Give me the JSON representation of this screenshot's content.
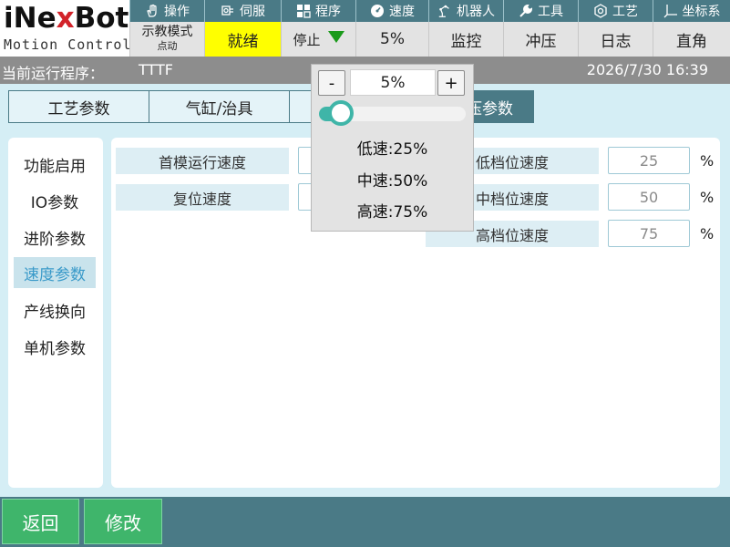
{
  "logo": {
    "brand_pre": "iNe",
    "brand_x": "x",
    "brand_post": "Bot",
    "subtitle": "Motion Control"
  },
  "top_tabs": [
    {
      "label": "操作",
      "icon": "hand-icon"
    },
    {
      "label": "伺服",
      "icon": "servo-icon"
    },
    {
      "label": "程序",
      "icon": "grid-icon"
    },
    {
      "label": "速度",
      "icon": "gauge-icon"
    },
    {
      "label": "机器人",
      "icon": "robot-arm-icon"
    },
    {
      "label": "工具",
      "icon": "wrench-icon"
    },
    {
      "label": "工艺",
      "icon": "process-icon"
    },
    {
      "label": "坐标系",
      "icon": "axis-icon"
    }
  ],
  "status": {
    "mode_main": "示教模式",
    "mode_sub": "点动",
    "state": "就绪",
    "run_state": "停止",
    "speed": "5%",
    "monitor": "监控",
    "stamping": "冲压",
    "log": "日志",
    "coord": "直角"
  },
  "program_bar": {
    "label": "当前运行程序：",
    "program": "TTTF",
    "datetime": "2026/7/30 16:39"
  },
  "param_tabs": [
    {
      "label": "工艺参数",
      "active": false
    },
    {
      "label": "气缸/治具",
      "active": false
    },
    {
      "label": "压参数",
      "active": true
    }
  ],
  "left_nav": [
    {
      "label": "功能启用",
      "active": false
    },
    {
      "label": "IO参数",
      "active": false
    },
    {
      "label": "进阶参数",
      "active": false
    },
    {
      "label": "速度参数",
      "active": true
    },
    {
      "label": "产线换向",
      "active": false
    },
    {
      "label": "单机参数",
      "active": false
    }
  ],
  "fields_left": [
    {
      "label": "首模运行速度"
    },
    {
      "label": "复位速度"
    }
  ],
  "fields_right": [
    {
      "label": "低档位速度",
      "value": "25",
      "unit": "%"
    },
    {
      "label": "中档位速度",
      "value": "50",
      "unit": "%"
    },
    {
      "label": "高档位速度",
      "value": "75",
      "unit": "%"
    }
  ],
  "speed_popup": {
    "minus": "-",
    "plus": "+",
    "value": "5%",
    "slider_percent": 5,
    "presets": [
      "低速:25%",
      "中速:50%",
      "高速:75%"
    ]
  },
  "footer": {
    "back": "返回",
    "edit": "修改"
  },
  "colors": {
    "teal": "#4a7a86",
    "ready_yellow": "#ffff00",
    "green_button": "#3fb56b",
    "slider": "#3fb5a8",
    "stop_arrow": "#1a9a1a"
  }
}
